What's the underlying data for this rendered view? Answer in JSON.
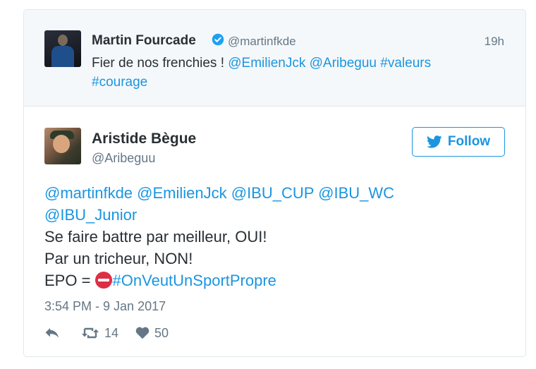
{
  "quoted_tweet": {
    "author_name": "Martin Fourcade",
    "handle": "@martinfkde",
    "time": "19h",
    "text_plain": "Fier de nos frenchies ! ",
    "mention_1": "@EmilienJck",
    "mention_2": "@Aribeguu",
    "hashtag_1": "#valeurs",
    "hashtag_2": "#courage",
    "avatar_icon": "profile-photo"
  },
  "main_tweet": {
    "author_name": "Aristide Bègue",
    "handle": "@Aribeguu",
    "follow_label": "Follow",
    "mentions_line_1": "@martinfkde @EmilienJck @IBU_CUP @IBU_WC",
    "mentions_line_2": "@IBU_Junior",
    "line_3": "Se faire battre par meilleur, OUI!",
    "line_4": "Par un tricheur, NON!",
    "line_5_prefix": "EPO = ",
    "hashtag": "#OnVeutUnSportPropre",
    "timestamp": "3:54 PM - 9 Jan 2017",
    "retweet_count": "14",
    "like_count": "50"
  },
  "colors": {
    "accent": "#1b95e0",
    "text": "#292f33",
    "muted": "#657786",
    "quoted_bg": "#f5f8fa",
    "no_entry": "#dd2e44"
  },
  "icons": {
    "verified": "verified-badge-icon",
    "twitter": "twitter-bird-icon",
    "reply": "reply-icon",
    "retweet": "retweet-icon",
    "like": "heart-icon",
    "emoji": "no-entry-emoji"
  }
}
